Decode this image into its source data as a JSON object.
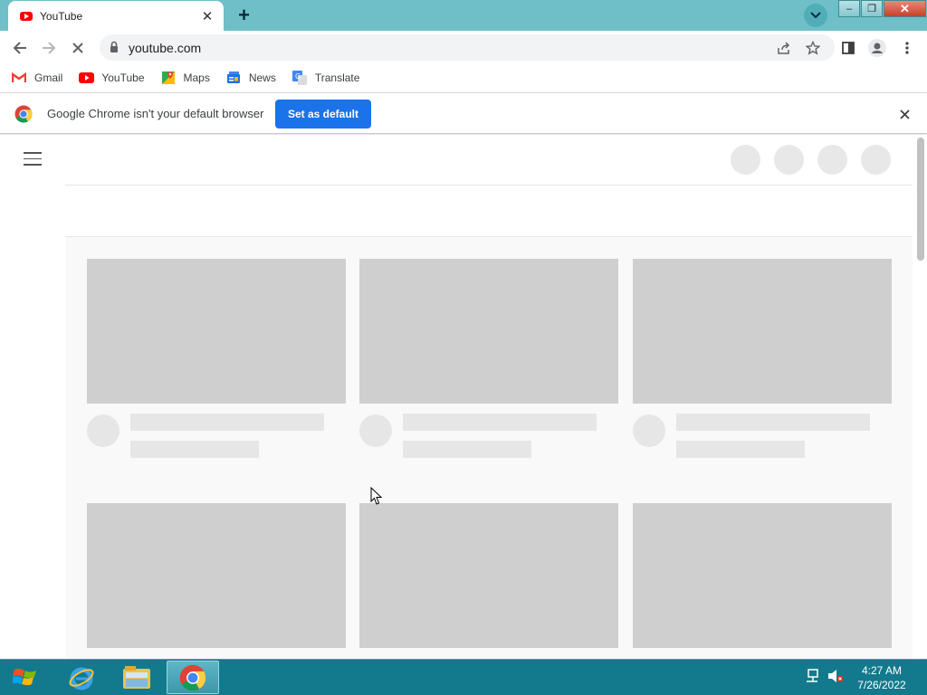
{
  "browser": {
    "tab": {
      "title": "YouTube",
      "close_glyph": "✕"
    },
    "new_tab_glyph": "+",
    "window_buttons": {
      "minimize": "–",
      "restore": "❐",
      "close": "✕"
    },
    "address": {
      "url": "youtube.com"
    },
    "bookmarks": [
      {
        "label": "Gmail",
        "icon": "gmail-icon"
      },
      {
        "label": "YouTube",
        "icon": "youtube-icon"
      },
      {
        "label": "Maps",
        "icon": "maps-icon"
      },
      {
        "label": "News",
        "icon": "news-icon"
      },
      {
        "label": "Translate",
        "icon": "translate-icon"
      }
    ],
    "infobar": {
      "message": "Google Chrome isn't your default browser",
      "button_label": "Set as default"
    }
  },
  "colors": {
    "accent": "#1a73e8",
    "titlebar": "#6fbfc8",
    "taskbar": "#137a8d",
    "placeholder": "#cfcfcf"
  },
  "taskbar": {
    "time": "4:27 AM",
    "date": "7/26/2022",
    "apps": [
      "internet-explorer-icon",
      "file-explorer-icon",
      "chrome-icon"
    ]
  }
}
